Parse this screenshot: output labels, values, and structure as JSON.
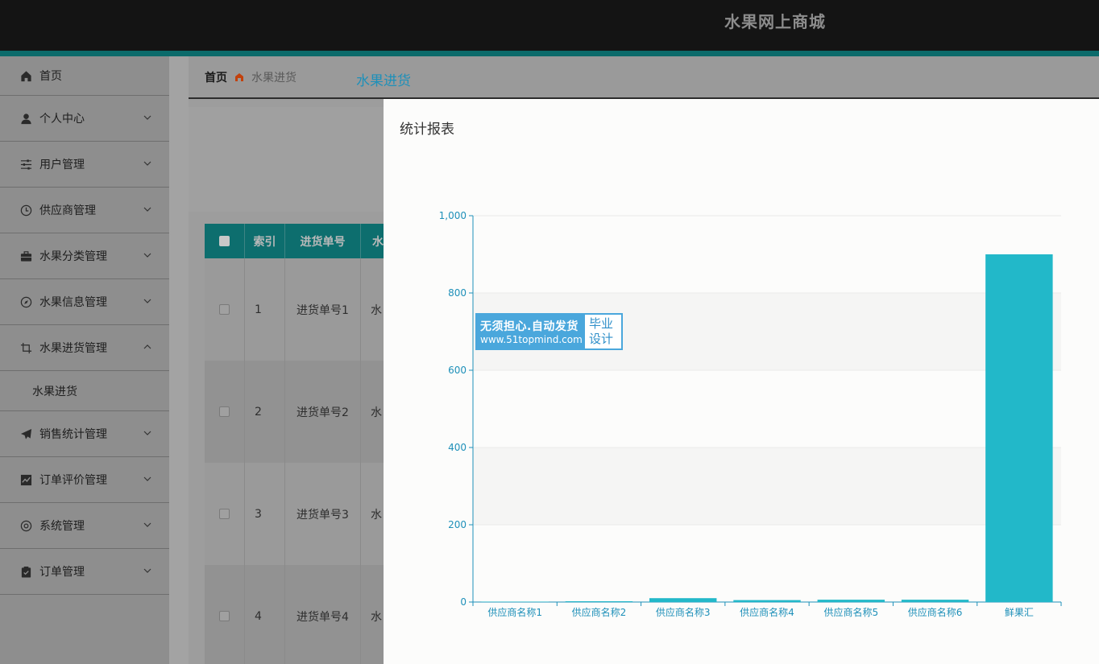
{
  "header": {
    "site_title": "水果网上商城"
  },
  "sidebar": {
    "items": [
      {
        "label": "首页",
        "icon": "home-icon",
        "chevron": false
      },
      {
        "label": "个人中心",
        "icon": "user-icon",
        "chevron": "down"
      },
      {
        "label": "用户管理",
        "icon": "sliders-icon",
        "chevron": "down"
      },
      {
        "label": "供应商管理",
        "icon": "clock-icon",
        "chevron": "down"
      },
      {
        "label": "水果分类管理",
        "icon": "briefcase-icon",
        "chevron": "down"
      },
      {
        "label": "水果信息管理",
        "icon": "compass-icon",
        "chevron": "down"
      },
      {
        "label": "水果进货管理",
        "icon": "crop-icon",
        "chevron": "up"
      },
      {
        "label": "销售统计管理",
        "icon": "paper-plane-icon",
        "chevron": "down"
      },
      {
        "label": "订单评价管理",
        "icon": "trend-chart-icon",
        "chevron": "down"
      },
      {
        "label": "系统管理",
        "icon": "settings-circle-icon",
        "chevron": "down"
      },
      {
        "label": "订单管理",
        "icon": "clipboard-icon",
        "chevron": "down"
      }
    ],
    "submenu": {
      "label": "水果进货"
    }
  },
  "breadcrumb": {
    "home": "首页",
    "current": "水果进货"
  },
  "table": {
    "headers": [
      "索引",
      "进货单号",
      "水"
    ],
    "rows": [
      {
        "index": "1",
        "order_no": "进货单号1",
        "partial": "水"
      },
      {
        "index": "2",
        "order_no": "进货单号2",
        "partial": "水"
      },
      {
        "index": "3",
        "order_no": "进货单号3",
        "partial": "水"
      },
      {
        "index": "4",
        "order_no": "进货单号4",
        "partial": "水"
      }
    ]
  },
  "modal": {
    "title": "统计报表"
  },
  "watermark": {
    "line1": "无须担心.自动发货",
    "line2": "www.51topmind.com",
    "right_line1": "毕业",
    "right_line2": "设计"
  },
  "colors": {
    "bar": "#22b8c9",
    "axis": "#1e90b9",
    "header_teal": "#0d6e6e"
  },
  "chart_data": {
    "type": "bar",
    "title": "水果进货",
    "categories": [
      "供应商名称1",
      "供应商名称2",
      "供应商名称3",
      "供应商名称4",
      "供应商名称5",
      "供应商名称6",
      "鲜果汇"
    ],
    "values": [
      1,
      2,
      10,
      5,
      6,
      6,
      900
    ],
    "ylim": [
      0,
      1000
    ],
    "yticks": [
      "0",
      "200",
      "400",
      "600",
      "800",
      "1,000"
    ],
    "grid": true
  }
}
